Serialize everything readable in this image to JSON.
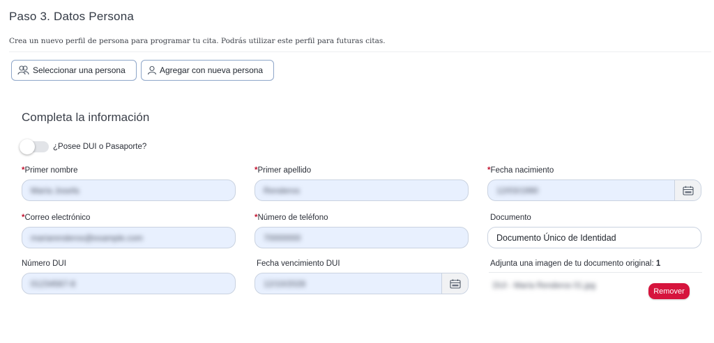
{
  "header": {
    "title": "Paso 3. Datos Persona",
    "description": "Crea un nuevo perfil de persona para programar tu cita. Podrás utilizar este perfil para futuras citas."
  },
  "actions": {
    "select_person": "Seleccionar una persona",
    "add_person": "Agregar con nueva persona"
  },
  "form": {
    "title": "Completa la información",
    "toggle": {
      "label": "¿Posee DUI o Pasaporte?",
      "checked": false
    },
    "required_mark": "*",
    "fields": {
      "first_name": {
        "label": "Primer nombre",
        "value": "María Josefa"
      },
      "last_name": {
        "label": "Primer apellido",
        "value": "Renderos"
      },
      "birth_date": {
        "label": "Fecha nacimiento",
        "value": "12/03/1990"
      },
      "email": {
        "label": "Correo electrónico",
        "value": "mariarenderos@example.com"
      },
      "phone": {
        "label": "Número de teléfono",
        "value": "70000000"
      },
      "document": {
        "label": "Documento",
        "value": "Documento Único de Identidad"
      },
      "dui": {
        "label": "Número DUI",
        "value": "01234567-8"
      },
      "dui_expiry": {
        "label": "Fecha vencimiento DUI",
        "value": "12/10/2028"
      }
    },
    "attachment": {
      "label": "Adjunta una imagen de tu documento original:",
      "count": "1",
      "file_name": "DUI - María Renderos 01.jpg",
      "remove_label": "Remover"
    }
  },
  "colors": {
    "accent_border": "#8ea6c9",
    "input_fill": "#e8f0fe",
    "required": "#c1122f",
    "remove_button": "#d6143d"
  },
  "icons": [
    "people-icon",
    "person-icon",
    "calendar-icon"
  ]
}
